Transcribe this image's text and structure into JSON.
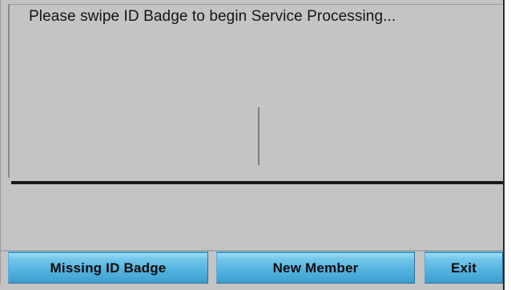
{
  "prompt": {
    "text": "Please swipe ID Badge to begin Service Processing..."
  },
  "buttons": {
    "missing_id_badge": "Missing ID Badge",
    "new_member": "New Member",
    "exit": "Exit"
  },
  "colors": {
    "panel_background": "#c4c4c4",
    "button_gradient_top": "#9fdcf4",
    "button_gradient_bottom": "#3e9fd0",
    "divider": "#1a1a1a"
  }
}
